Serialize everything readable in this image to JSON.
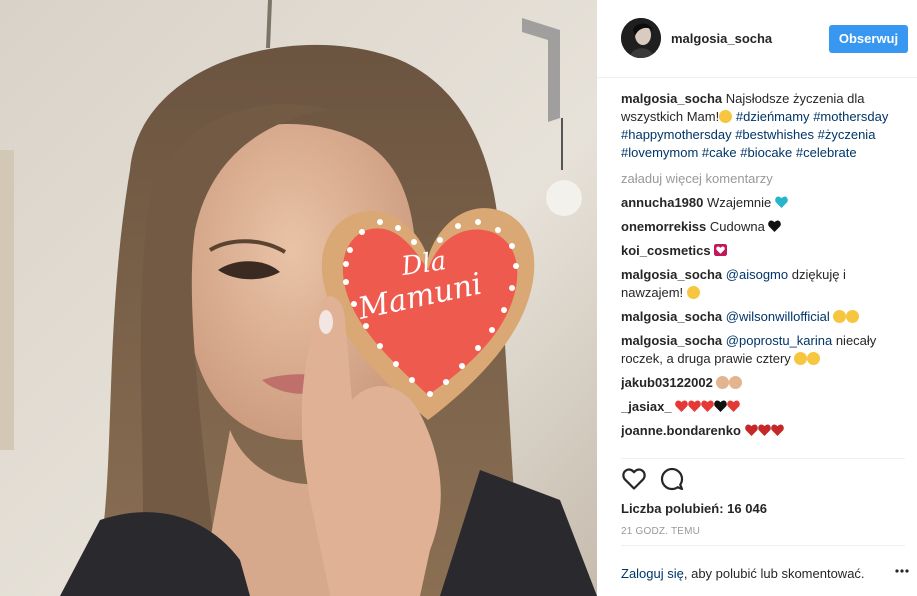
{
  "post": {
    "username": "malgosia_socha",
    "follow_label": "Obserwuj",
    "cookie_text_line1": "Dla",
    "cookie_text_line2": "Mamuni"
  },
  "caption": {
    "user": "malgosia_socha",
    "text": " Najsłodsze życzenia dla wszystkich Mam!",
    "emoji": "smiling-face-with-heart-eyes",
    "hashtags": [
      "#dzieńmamy",
      "#mothersday",
      "#happymothersday",
      "#bestwhishes",
      "#życzenia",
      "#lovemymom",
      "#cake",
      "#biocake",
      "#celebrate"
    ]
  },
  "load_more": "załaduj więcej komentarzy",
  "comments": [
    {
      "user": "annucha1980",
      "text": " Wzajemnie ",
      "emoji": "blue-heart"
    },
    {
      "user": "onemorrekiss",
      "text": " Cudowna ",
      "emoji": "black-heart"
    },
    {
      "user": "koi_cosmetics",
      "text": " ",
      "emoji": "heart-decoration"
    },
    {
      "user": "malgosia_socha",
      "mention": "@aisogmo",
      "text": " dziękuję i nawzajem! ",
      "emoji": "astonished-face"
    },
    {
      "user": "malgosia_socha",
      "mention": "@wilsonwillofficial",
      "text": " ",
      "emoji": "astonished-face x2"
    },
    {
      "user": "malgosia_socha",
      "mention": "@poprostu_karina",
      "text": " niecały roczek, a druga prawie cztery ",
      "emoji": "smiling-face x2"
    },
    {
      "user": "jakub03122002",
      "text": " ",
      "emoji": "clapping-hands x2"
    },
    {
      "user": "_jasiax_",
      "text": " ",
      "emoji": "hearts sequence"
    },
    {
      "user": "joanne.bondarenko",
      "text": " ",
      "emoji": "red-heart x3"
    }
  ],
  "likes_label": "Liczba polubień: 16 046",
  "time_label": "21 GODZ. TEMU",
  "footer": {
    "login": "Zaloguj się",
    "rest": ", aby polubić lub skomentować."
  },
  "icons": {
    "like": "heart-outline-icon",
    "comment": "speech-bubble-icon",
    "more": "ellipsis-icon"
  },
  "colors": {
    "accent": "#3897f0",
    "link": "#003569",
    "muted": "#999999",
    "cookie_icing": "#ef5a4f"
  }
}
